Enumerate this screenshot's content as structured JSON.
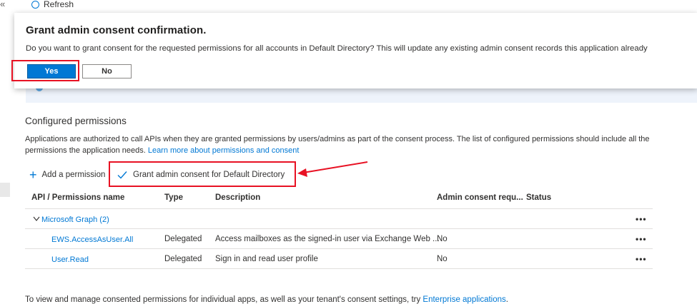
{
  "top": {
    "collapse_glyph": "«",
    "refresh_label": "Refresh"
  },
  "dialog": {
    "title": "Grant admin consent confirmation.",
    "message": "Do you want to grant consent for the requested permissions for all accounts in Default Directory? This will update any existing admin consent records this application already",
    "yes_label": "Yes",
    "no_label": "No"
  },
  "section": {
    "title": "Configured permissions",
    "description": "Applications are authorized to call APIs when they are granted permissions by users/admins as part of the consent process. The list of configured permissions should include all the permissions the application needs.",
    "learn_more": "Learn more about permissions and consent"
  },
  "toolbar": {
    "add_permission": "Add a permission",
    "grant_consent": "Grant admin consent for Default Directory"
  },
  "table": {
    "columns": [
      "API / Permissions name",
      "Type",
      "Description",
      "Admin consent requ...",
      "Status"
    ],
    "group": {
      "label": "Microsoft Graph (2)"
    },
    "rows": [
      {
        "name": "EWS.AccessAsUser.All",
        "type": "Delegated",
        "description": "Access mailboxes as the signed-in user via Exchange Web ...",
        "admin_consent": "No",
        "status": ""
      },
      {
        "name": "User.Read",
        "type": "Delegated",
        "description": "Sign in and read user profile",
        "admin_consent": "No",
        "status": ""
      }
    ],
    "more_glyph": "•••"
  },
  "footer": {
    "text": "To view and manage consented permissions for individual apps, as well as your tenant's consent settings, try",
    "link": "Enterprise applications",
    "end": "."
  },
  "colors": {
    "accent": "#0078d4",
    "highlight": "#e81123"
  }
}
